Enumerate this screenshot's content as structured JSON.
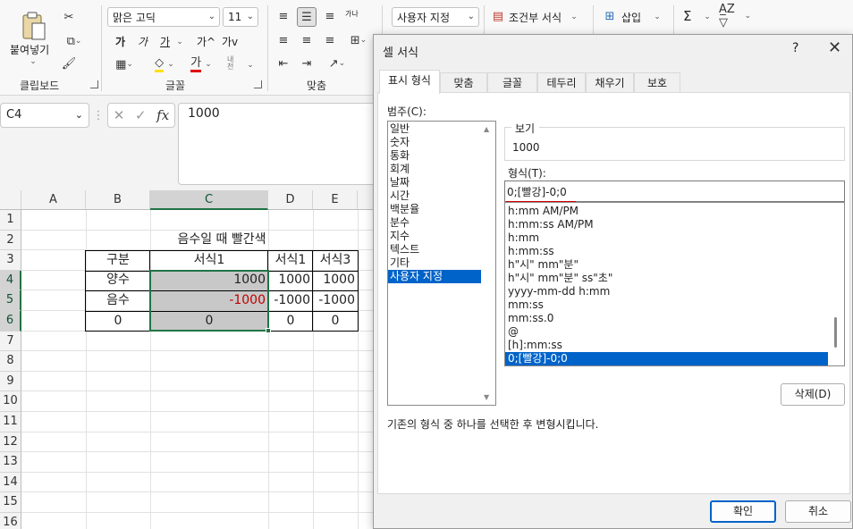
{
  "ribbon": {
    "clipboard": {
      "paste_label": "붙여넣기",
      "group_label": "클립보드"
    },
    "font": {
      "name": "맑은 고딕",
      "size": "11",
      "group_label": "글꼴",
      "bold": "가",
      "italic": "가",
      "underline": "가",
      "grow": "가^",
      "shrink": "가v",
      "color_glyph": "가",
      "phonetic": "내천"
    },
    "alignment": {
      "group_label": "맞춤",
      "wrap": "가나"
    },
    "number": {
      "format": "사용자 지정"
    },
    "styles": {
      "conditional": "조건부 서식"
    },
    "cells": {
      "insert": "삽입"
    },
    "editing": {
      "sum": "Σ"
    }
  },
  "formula_bar": {
    "name_box": "C4",
    "value": "1000",
    "fx": "fx"
  },
  "sheet": {
    "columns": [
      "A",
      "B",
      "C",
      "D",
      "E"
    ],
    "rows": [
      "1",
      "2",
      "3",
      "4",
      "5",
      "6",
      "7",
      "8",
      "9",
      "10",
      "11",
      "12",
      "13",
      "14",
      "15",
      "16"
    ],
    "title": "음수일 때 빨간색",
    "headers": [
      "구분",
      "서식1",
      "서식1",
      "서식3"
    ],
    "data": [
      [
        "양수",
        "1000",
        "1000",
        "1000"
      ],
      [
        "음수",
        "-1000",
        "-1000",
        "-1000"
      ],
      [
        "0",
        "0",
        "0",
        "0"
      ]
    ],
    "negative_color": "#c00000",
    "selected_fill": "#c8c8c8"
  },
  "dialog": {
    "title": "셀 서식",
    "help": "?",
    "close": "✕",
    "tabs": [
      "표시 형식",
      "맞춤",
      "글꼴",
      "테두리",
      "채우기",
      "보호"
    ],
    "category_label": "범주(C):",
    "categories": [
      "일반",
      "숫자",
      "통화",
      "회계",
      "날짜",
      "시간",
      "백분율",
      "분수",
      "지수",
      "텍스트",
      "기타",
      "사용자 지정"
    ],
    "selected_category": "사용자 지정",
    "sample_label": "보기",
    "sample_value": "1000",
    "format_label": "형식(T):",
    "format_value": "0;[빨강]-0;0",
    "formats": [
      "h:mm AM/PM",
      "h:mm:ss AM/PM",
      "h:mm",
      "h:mm:ss",
      "h\"시\" mm\"분\"",
      "h\"시\" mm\"분\" ss\"초\"",
      "yyyy-mm-dd h:mm",
      "mm:ss",
      "mm:ss.0",
      "@",
      "[h]:mm:ss",
      "0;[빨강]-0;0"
    ],
    "delete_label": "삭제(D)",
    "hint": "기존의 형식 중 하나를 선택한 후 변형시킵니다.",
    "ok_label": "확인",
    "cancel_label": "취소",
    "accent": "#0063c9"
  }
}
